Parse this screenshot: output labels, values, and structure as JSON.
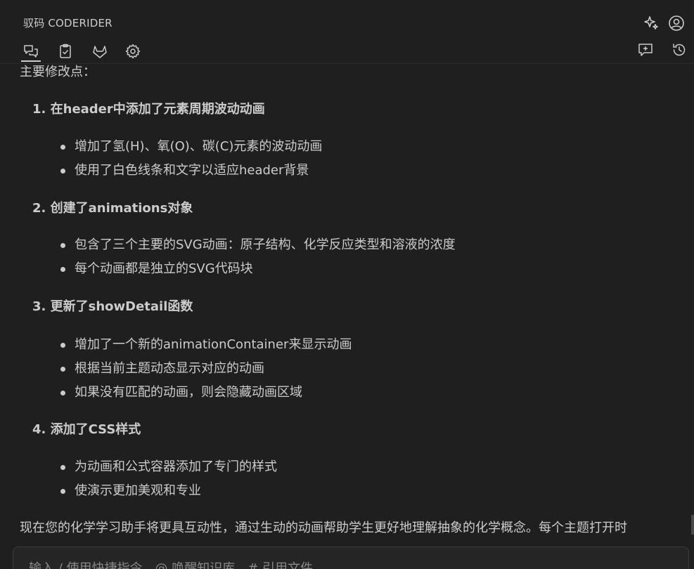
{
  "header": {
    "title": "驭码 CODERIDER",
    "icons": {
      "sparkle": "sparkle-icon",
      "account": "account-icon",
      "chat": "chat-icon",
      "tasks": "clipboard-check-icon",
      "gitlab": "gitlab-icon",
      "settings": "gear-icon",
      "new_chat": "new-chat-icon",
      "history": "history-icon"
    }
  },
  "message": {
    "intro": "主要修改点：",
    "sections": [
      {
        "title": "1. 在header中添加了元素周期波动动画",
        "bullets": [
          "增加了氢(H)、氧(O)、碳(C)元素的波动动画",
          "使用了白色线条和文字以适应header背景"
        ]
      },
      {
        "title": "2. 创建了animations对象",
        "bullets": [
          "包含了三个主要的SVG动画：原子结构、化学反应类型和溶液的浓度",
          "每个动画都是独立的SVG代码块"
        ]
      },
      {
        "title": "3. 更新了showDetail函数",
        "bullets": [
          "增加了一个新的animationContainer来显示动画",
          "根据当前主题动态显示对应的动画",
          "如果没有匹配的动画，则会隐藏动画区域"
        ]
      },
      {
        "title": "4. 添加了CSS样式",
        "bullets": [
          "为动画和公式容器添加了专门的样式",
          "使演示更加美观和专业"
        ]
      }
    ],
    "outro": "现在您的化学学习助手将更具互动性，通过生动的动画帮助学生更好地理解抽象的化学概念。每个主题打开时"
  },
  "input": {
    "placeholder": "输入 / 使用快捷指令，@ 唤醒知识库，# 引用文件"
  },
  "colors": {
    "background": "#1f1f1f",
    "text": "#cccccc",
    "border": "#3c3c3c"
  }
}
